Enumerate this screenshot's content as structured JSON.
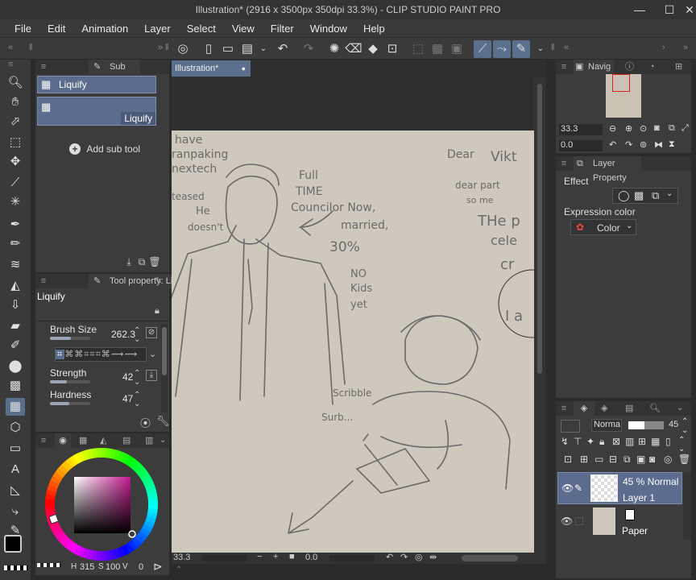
{
  "window": {
    "title": "Illustration* (2916 x 3500px 350dpi 33.3%) - CLIP STUDIO PAINT PRO",
    "minimize": "—",
    "maximize": "☐",
    "close": "✕"
  },
  "menu": [
    "File",
    "Edit",
    "Animation",
    "Layer",
    "Select",
    "View",
    "Filter",
    "Window",
    "Help"
  ],
  "subtool": {
    "tab_label": "Sub Tool",
    "items": [
      {
        "label": "Liquify"
      },
      {
        "label": "Liquify"
      }
    ],
    "add_label": "Add sub tool"
  },
  "toolprop": {
    "tab_label": "Tool property: Liqui",
    "title": "Liquify",
    "brush_size": {
      "label": "Brush Size",
      "value": "262.3",
      "level": 0.52
    },
    "strength": {
      "label": "Strength",
      "value": "42",
      "level": 0.42
    },
    "hardness": {
      "label": "Hardness",
      "value": "47",
      "level": 0.47
    }
  },
  "color": {
    "bottom_text": "315",
    "bottom_values": "100",
    "bottom_v2": "0"
  },
  "canvas": {
    "tab_label": "Illustration*",
    "zoom": "33.3",
    "angle": "0.0"
  },
  "navigator": {
    "tab_label": "Navig",
    "zoom": "33.3",
    "angle": "0.0"
  },
  "layer_property": {
    "tab_label": "Layer Property",
    "effect_label": "Effect",
    "expression_label": "Expression color",
    "color_option": "Color"
  },
  "layers": {
    "blend_mode": "Norma",
    "opacity": "45",
    "items": [
      {
        "mode": "45 % Normal",
        "name": "Layer 1"
      },
      {
        "mode": "",
        "name": "Paper"
      }
    ]
  },
  "drawing_text": {
    "have": "have",
    "ranpaking": "ranpaking",
    "nextech": "nextech",
    "teased": "teased",
    "he": "He",
    "doesnt": "doesn't",
    "full": "Full",
    "time": "TIME",
    "councilor": "Councilor Now,",
    "married": "married,",
    "thirty": "30%",
    "no": "NO",
    "kids": "Kids",
    "yet": "yet",
    "dear": "Dear",
    "vikt": "Vikt",
    "dear_part": "dear part",
    "so_me": "so me",
    "the_p": "THe p",
    "cele": "cele",
    "cr": "cr",
    "i": "I a",
    "scribble": "Scribble",
    "surpr": "Surb..."
  },
  "colors": {
    "accent": "#5a6e8e",
    "paper": "#cfc8bc",
    "sketch": "#6b6b6b"
  }
}
